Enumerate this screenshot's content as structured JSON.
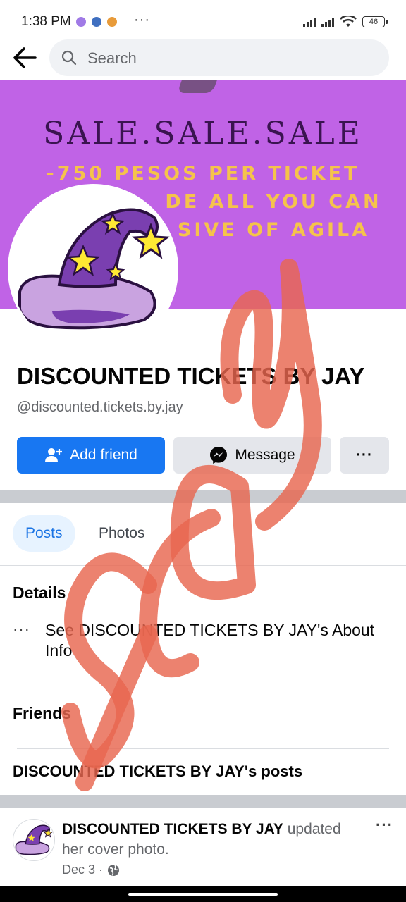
{
  "status_bar": {
    "time": "1:38 PM",
    "more": "···",
    "battery": "46"
  },
  "search": {
    "placeholder": "Search"
  },
  "cover": {
    "line1": "SALE.SALE.SALE",
    "line2": "-750 PESOS PER TICKET",
    "line3": "DE ALL YOU CAN",
    "line4": "SIVE OF AGILA",
    "background_color": "#c063e6"
  },
  "profile": {
    "name": "DISCOUNTED TICKETS BY JAY",
    "handle": "@discounted.tickets.by.jay"
  },
  "actions": {
    "add_friend": "Add friend",
    "message": "Message",
    "more": "···"
  },
  "tabs": [
    {
      "label": "Posts",
      "active": true
    },
    {
      "label": "Photos",
      "active": false
    }
  ],
  "details": {
    "title": "Details",
    "dots": "···",
    "about_link": "See DISCOUNTED TICKETS BY JAY's About Info"
  },
  "friends": {
    "title": "Friends"
  },
  "posts_section": {
    "title": "DISCOUNTED TICKETS BY JAY's posts"
  },
  "post": {
    "author": "DISCOUNTED TICKETS BY JAY",
    "action": " updated her cover photo.",
    "date": "Dec 3 ·",
    "more": "···"
  },
  "overlay": {
    "text": "SCAM",
    "color": "#e8664f"
  },
  "colors": {
    "accent": "#1877f2",
    "hat_purple": "#7a3fb0",
    "star_yellow": "#ffe933"
  }
}
